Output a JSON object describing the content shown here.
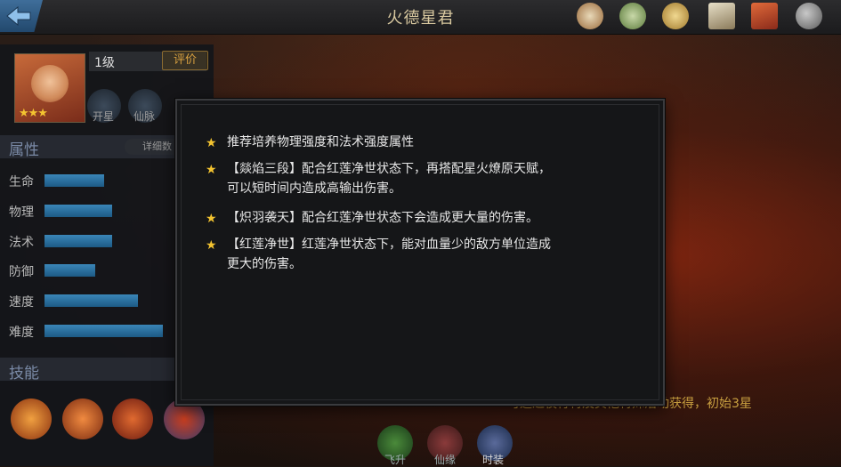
{
  "header": {
    "title": "火德星君"
  },
  "hero": {
    "level": "1级",
    "rate_label": "评价",
    "stars": "★★★"
  },
  "mini_buttons": [
    "开星",
    "仙脉"
  ],
  "sections": {
    "attributes": "属性",
    "detail": "详细数",
    "skills": "技能"
  },
  "attributes": [
    {
      "label": "生命",
      "value": 0.35
    },
    {
      "label": "物理",
      "value": 0.4
    },
    {
      "label": "法术",
      "value": 0.4
    },
    {
      "label": "防御",
      "value": 0.3
    },
    {
      "label": "速度",
      "value": 0.55
    },
    {
      "label": "难度",
      "value": 0.7
    }
  ],
  "bottom_buttons": [
    "飞升",
    "仙缘",
    "时装"
  ],
  "footnote": "可通过夜行特及其他特殊活动获得，初始3星",
  "modal": {
    "tips": [
      "推荐培养物理强度和法术强度属性",
      "【燚焰三段】配合红莲净世状态下，再搭配星火燎原天赋，\n可以短时间内造成高输出伤害。",
      "【炽羽袭天】配合红莲净世状态下会造成更大量的伤害。",
      "【红莲净世】红莲净世状态下，能对血量少的敌方单位造成\n更大的伤害。"
    ]
  },
  "icons": {
    "back": "back-arrow-icon",
    "top": [
      "scroll-seal-icon",
      "rolled-scroll-icon",
      "coin-icon",
      "paper-scroll-icon",
      "book-icon",
      "search-icon"
    ]
  },
  "colors": {
    "star": "#f4c430",
    "title": "#d9c9a0",
    "bar": "#3a86b8",
    "footnote": "#c9a040"
  }
}
